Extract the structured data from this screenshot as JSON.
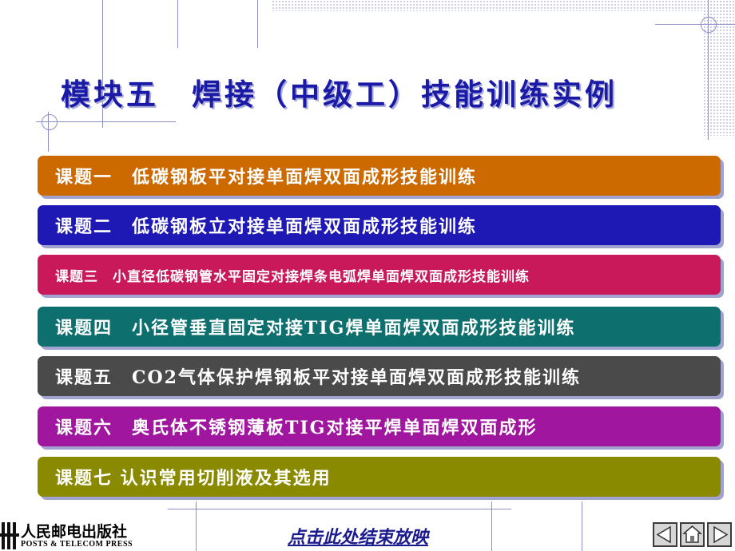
{
  "slide": {
    "title": "模块五　焊接（中级工）技能训练实例",
    "topics": [
      {
        "label": "课题一　低碳钢板平对接单面焊双面成形技能训练",
        "color": "#cc6a00"
      },
      {
        "label": "课题二　低碳钢板立对接单面焊双面成形技能训练",
        "color": "#1e18b4"
      },
      {
        "label": "课题三　小直径低碳钢管水平固定对接焊条电弧焊单面焊双面成形技能训练",
        "color": "#c9195a"
      },
      {
        "label": "课题四　小径管垂直固定对接TIG焊单面焊双面成形技能训练",
        "color": "#0d6f6e"
      },
      {
        "label": "课题五　CO2气体保护焊钢板平对接单面焊双面成形技能训练",
        "color": "#4a4a4a"
      },
      {
        "label": "课题六　奥氏体不锈钢薄板TIG对接平焊单面焊双面成形",
        "color": "#a0169f"
      },
      {
        "label": "课题七 认识常用切削液及其选用",
        "color": "#8a8a00"
      }
    ]
  },
  "footer": {
    "publisher_cn": "人民邮电出版社",
    "publisher_en": "POSTS & TELECOM PRESS",
    "end_show": "点击此处结束放映",
    "nav": {
      "prev_icon": "back-arrow-icon",
      "home_icon": "home-icon",
      "next_icon": "forward-arrow-icon"
    }
  }
}
